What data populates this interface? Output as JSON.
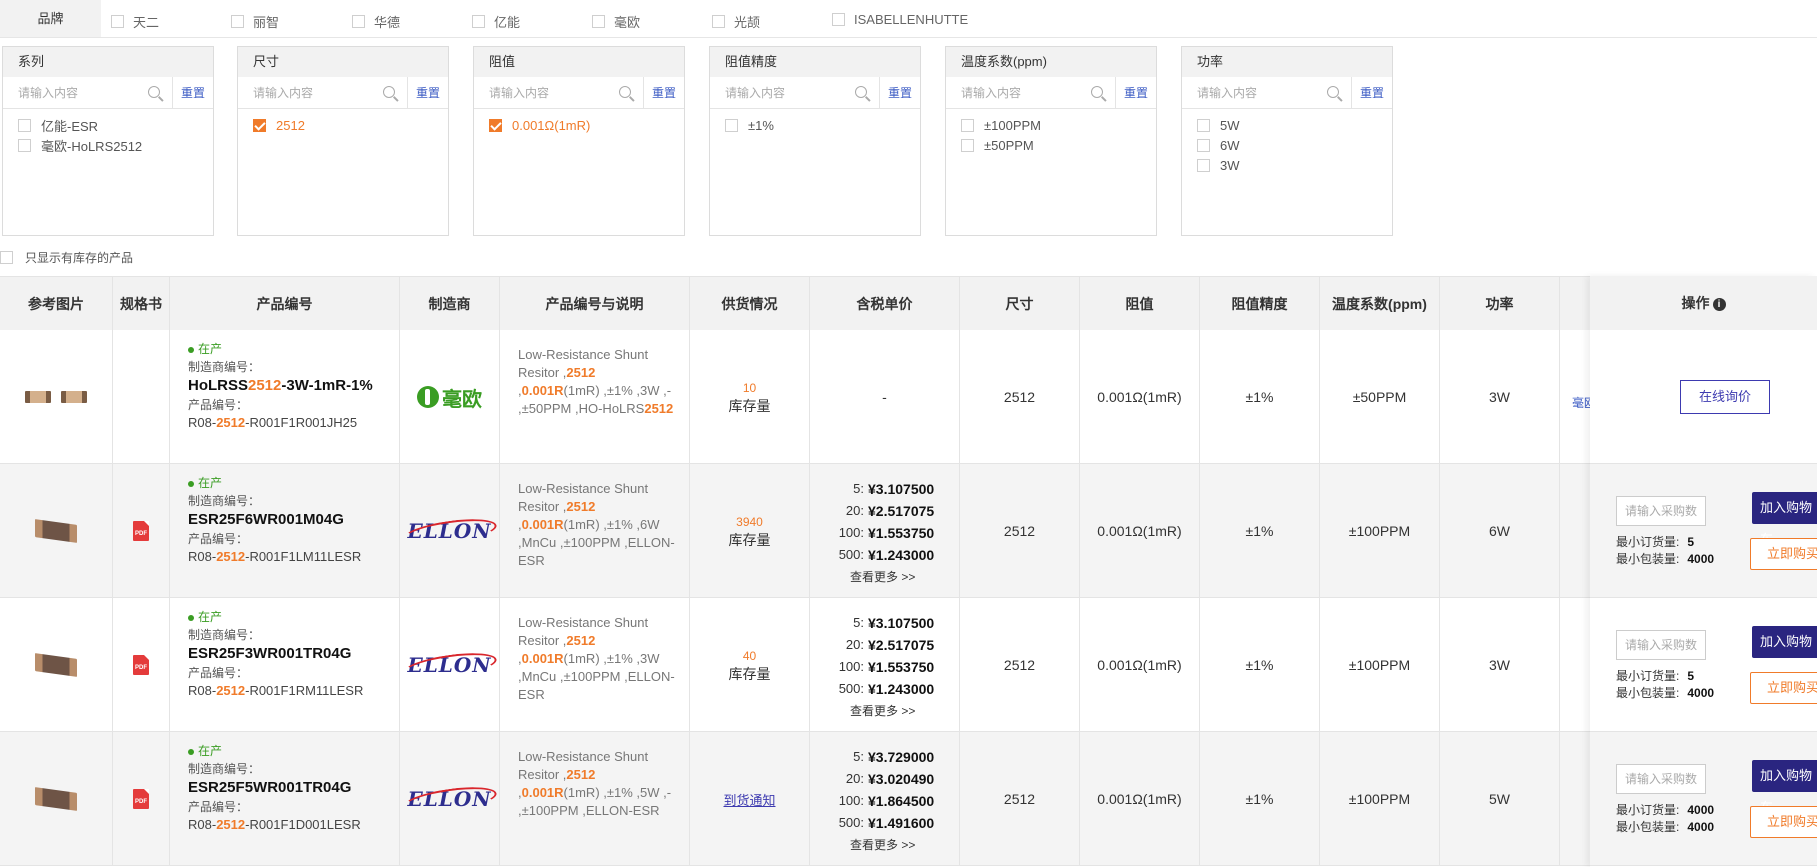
{
  "brand_filter": {
    "label": "品牌",
    "items": [
      "天二",
      "丽智",
      "华德",
      "亿能",
      "毫欧",
      "光颉",
      "ISABELLENHUTTE"
    ]
  },
  "filters": [
    {
      "title": "系列",
      "placeholder": "请输入内容",
      "reset": "重置",
      "options": [
        {
          "label": "亿能-ESR",
          "checked": false
        },
        {
          "label": "毫欧-HoLRS2512",
          "checked": false
        }
      ]
    },
    {
      "title": "尺寸",
      "placeholder": "请输入内容",
      "reset": "重置",
      "options": [
        {
          "label": "2512",
          "checked": true
        }
      ]
    },
    {
      "title": "阻值",
      "placeholder": "请输入内容",
      "reset": "重置",
      "options": [
        {
          "label": "0.001Ω(1mR)",
          "checked": true
        }
      ]
    },
    {
      "title": "阻值精度",
      "placeholder": "请输入内容",
      "reset": "重置",
      "options": [
        {
          "label": "±1%",
          "checked": false
        }
      ]
    },
    {
      "title": "温度系数(ppm)",
      "placeholder": "请输入内容",
      "reset": "重置",
      "options": [
        {
          "label": "±100PPM",
          "checked": false
        },
        {
          "label": "±50PPM",
          "checked": false
        }
      ]
    },
    {
      "title": "功率",
      "placeholder": "请输入内容",
      "reset": "重置",
      "options": [
        {
          "label": "5W",
          "checked": false
        },
        {
          "label": "6W",
          "checked": false
        },
        {
          "label": "3W",
          "checked": false
        }
      ]
    }
  ],
  "stock_only_label": "只显示有库存的产品",
  "table": {
    "headers": {
      "image": "参考图片",
      "datasheet": "规格书",
      "product": "产品编号",
      "mfr": "制造商",
      "desc": "产品编号与说明",
      "stock": "供货情况",
      "price": "含税单价",
      "size": "尺寸",
      "resistance": "阻值",
      "tolerance": "阻值精度",
      "tempco": "温度系数(ppm)",
      "power": "功率",
      "ops": "操作"
    },
    "labels": {
      "mfr_no": "制造商编号：",
      "prod_no": "产品编号：",
      "stock_unit": "库存量",
      "more": "查看更多 >>",
      "qty_placeholder": "请输入采购数",
      "min_order": "最小订货量:",
      "min_pack": "最小包装量:",
      "add_cart": "加入购物车",
      "buy_now": "立即购买",
      "inquire": "在线询价",
      "notify": "到货通知",
      "no_price": "-"
    },
    "rows": [
      {
        "status": "在产",
        "mpn_pre": "HoLRSS",
        "mpn_hl": "2512",
        "mpn_post": "-3W-1mR-1%",
        "pn_pre": "R08-",
        "pn_hl": "2512",
        "pn_post": "-R001F1R001JH25",
        "manufacturer": "毫欧",
        "desc_pre": "Low-Resistance Shunt Resitor ,",
        "desc_hl1": "2512",
        "desc_mid": " ,",
        "desc_hl2": "0.001R",
        "desc_post": "(1mR) ,±1% ,3W ,- ,±50PPM ,HO-HoLRS",
        "desc_hl3": "2512",
        "stock_qty": "10",
        "prices": [],
        "size": "2512",
        "resistance": "0.001Ω(1mR)",
        "tolerance": "±1%",
        "tempco": "±50PPM",
        "power": "3W",
        "partial": "毫欧"
      },
      {
        "status": "在产",
        "mpn_pre": "ESR25F6WR001M04G",
        "mpn_hl": "",
        "mpn_post": "",
        "pn_pre": "R08-",
        "pn_hl": "2512",
        "pn_post": "-R001F1LM11LESR",
        "manufacturer": "ELLON",
        "desc_pre": "Low-Resistance Shunt Resitor ,",
        "desc_hl1": "2512",
        "desc_mid": " ,",
        "desc_hl2": "0.001R",
        "desc_post": "(1mR) ,±1% ,6W ,MnCu ,±100PPM ,ELLON-ESR",
        "desc_hl3": "",
        "stock_qty": "3940",
        "prices": [
          {
            "q": "5:",
            "v": "¥3.107500"
          },
          {
            "q": "20:",
            "v": "¥2.517075"
          },
          {
            "q": "100:",
            "v": "¥1.553750"
          },
          {
            "q": "500:",
            "v": "¥1.243000"
          }
        ],
        "size": "2512",
        "resistance": "0.001Ω(1mR)",
        "tolerance": "±1%",
        "tempco": "±100PPM",
        "power": "6W",
        "min_order": "5",
        "min_pack": "4000"
      },
      {
        "status": "在产",
        "mpn_pre": "ESR25F3WR001TR04G",
        "mpn_hl": "",
        "mpn_post": "",
        "pn_pre": "R08-",
        "pn_hl": "2512",
        "pn_post": "-R001F1RM11LESR",
        "manufacturer": "ELLON",
        "desc_pre": "Low-Resistance Shunt Resitor ,",
        "desc_hl1": "2512",
        "desc_mid": " ,",
        "desc_hl2": "0.001R",
        "desc_post": "(1mR) ,±1% ,3W ,MnCu ,±100PPM ,ELLON-ESR",
        "desc_hl3": "",
        "stock_qty": "40",
        "prices": [
          {
            "q": "5:",
            "v": "¥3.107500"
          },
          {
            "q": "20:",
            "v": "¥2.517075"
          },
          {
            "q": "100:",
            "v": "¥1.553750"
          },
          {
            "q": "500:",
            "v": "¥1.243000"
          }
        ],
        "size": "2512",
        "resistance": "0.001Ω(1mR)",
        "tolerance": "±1%",
        "tempco": "±100PPM",
        "power": "3W",
        "min_order": "5",
        "min_pack": "4000"
      },
      {
        "status": "在产",
        "mpn_pre": "ESR25F5WR001TR04G",
        "mpn_hl": "",
        "mpn_post": "",
        "pn_pre": "R08-",
        "pn_hl": "2512",
        "pn_post": "-R001F1D001LESR",
        "manufacturer": "ELLON",
        "desc_pre": "Low-Resistance Shunt Resitor ,",
        "desc_hl1": "2512",
        "desc_mid": " ,",
        "desc_hl2": "0.001R",
        "desc_post": "(1mR) ,±1% ,5W ,- ,±100PPM ,ELLON-ESR",
        "desc_hl3": "",
        "stock_qty": "",
        "prices": [
          {
            "q": "5:",
            "v": "¥3.729000"
          },
          {
            "q": "20:",
            "v": "¥3.020490"
          },
          {
            "q": "100:",
            "v": "¥1.864500"
          },
          {
            "q": "500:",
            "v": "¥1.491600"
          }
        ],
        "size": "2512",
        "resistance": "0.001Ω(1mR)",
        "tolerance": "±1%",
        "tempco": "±100PPM",
        "power": "5W",
        "min_order": "4000",
        "min_pack": "4000"
      }
    ]
  }
}
